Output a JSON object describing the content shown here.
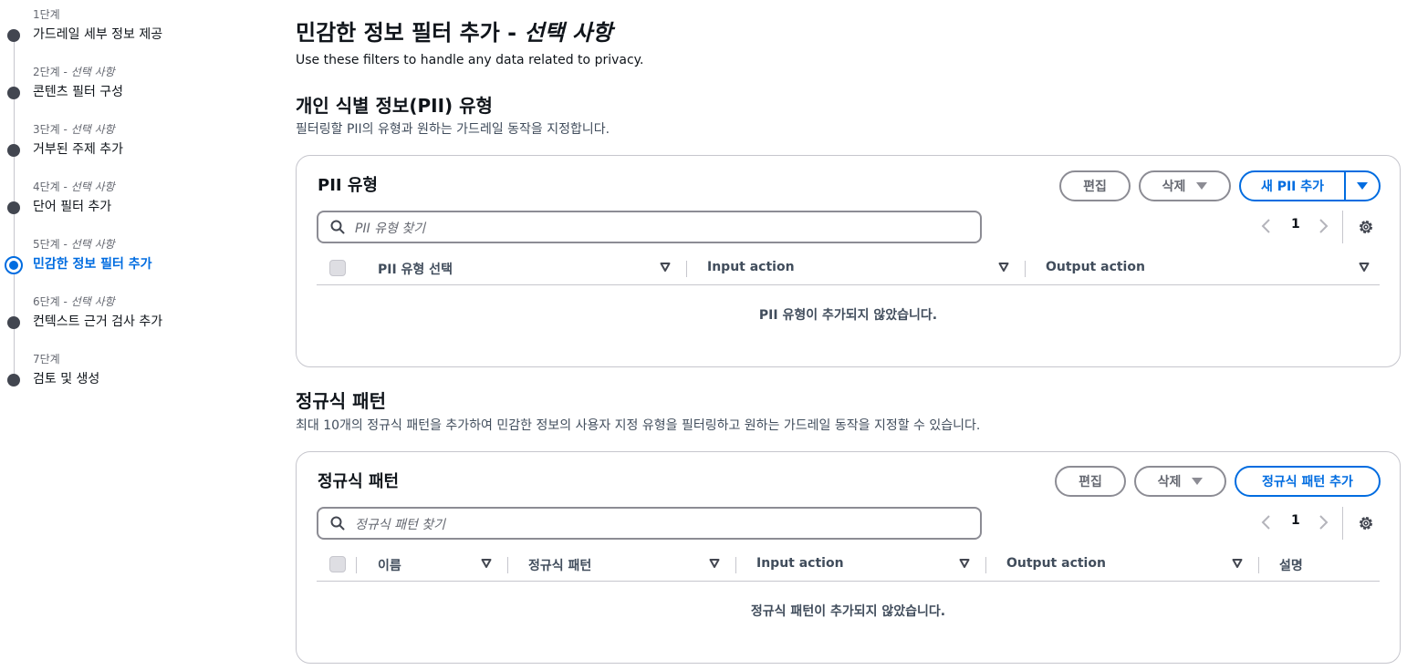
{
  "steps": [
    {
      "num": "1단계",
      "optional": "",
      "title": "가드레일 세부 정보 제공",
      "active": false
    },
    {
      "num": "2단계",
      "optional": "선택 사항",
      "title": "콘텐츠 필터 구성",
      "active": false
    },
    {
      "num": "3단계",
      "optional": "선택 사항",
      "title": "거부된 주제 추가",
      "active": false
    },
    {
      "num": "4단계",
      "optional": "선택 사항",
      "title": "단어 필터 추가",
      "active": false
    },
    {
      "num": "5단계",
      "optional": "선택 사항",
      "title": "민감한 정보 필터 추가",
      "active": true
    },
    {
      "num": "6단계",
      "optional": "선택 사항",
      "title": "컨텍스트 근거 검사 추가",
      "active": false
    },
    {
      "num": "7단계",
      "optional": "",
      "title": "검토 및 생성",
      "active": false
    }
  ],
  "step_optional_sep": " - ",
  "page": {
    "title": "민감한 정보 필터 추가",
    "title_sep": " - ",
    "title_optional": "선택 사항",
    "description": "Use these filters to handle any data related to privacy."
  },
  "pii_section": {
    "title": "개인 식별 정보(PII) 유형",
    "description": "필터링할 PII의 유형과 원하는 가드레일 동작을 지정합니다.",
    "panel_title": "PII 유형",
    "edit_label": "편집",
    "delete_label": "삭제",
    "add_label": "새 PII 추가",
    "search_placeholder": "PII 유형 찾기",
    "page_number": "1",
    "columns": [
      "PII 유형 선택",
      "Input action",
      "Output action"
    ],
    "empty_text": "PII 유형이 추가되지 않았습니다."
  },
  "regex_section": {
    "title": "정규식 패턴",
    "description": "최대 10개의 정규식 패턴을 추가하여 민감한 정보의 사용자 지정 유형을 필터링하고 원하는 가드레일 동작을 지정할 수 있습니다.",
    "panel_title": "정규식 패턴",
    "edit_label": "편집",
    "delete_label": "삭제",
    "add_label": "정규식 패턴 추가",
    "search_placeholder": "정규식 패턴 찾기",
    "page_number": "1",
    "columns": [
      "이름",
      "정규식 패턴",
      "Input action",
      "Output action",
      "설명"
    ],
    "empty_text": "정규식 패턴이 추가되지 않았습니다."
  },
  "colors": {
    "accent": "#006ce0",
    "text": "#0f141a",
    "muted": "#656871",
    "border": "#8c8c94"
  }
}
